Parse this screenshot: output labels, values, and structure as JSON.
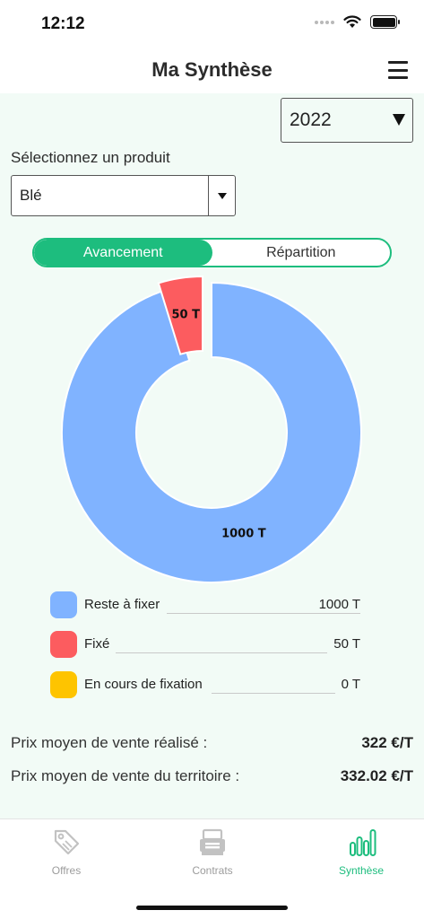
{
  "status_bar": {
    "time": "12:12"
  },
  "header": {
    "title": "Ma Synthèse"
  },
  "year_select": {
    "value": "2022"
  },
  "product": {
    "label": "Sélectionnez un produit",
    "value": "Blé"
  },
  "tabs": {
    "active": "Avancement",
    "inactive": "Répartition"
  },
  "chart_data": {
    "type": "pie",
    "categories": [
      "Reste à fixer",
      "Fixé",
      "En cours de fixation"
    ],
    "values": [
      1000,
      50,
      0
    ],
    "labels": [
      "1000 T",
      "50 T",
      "0 T"
    ],
    "colors": [
      "#80b3ff",
      "#fc5c5f",
      "#fec400"
    ]
  },
  "legend": [
    {
      "label": "Reste à fixer",
      "value": "1000 T",
      "color": "#80b3ff"
    },
    {
      "label": "Fixé",
      "value": "50 T",
      "color": "#fc5c5f"
    },
    {
      "label": "En cours de fixation",
      "value": "0 T",
      "color": "#fec400"
    }
  ],
  "prices": [
    {
      "label": "Prix moyen de vente réalisé :",
      "value": "322 €/T"
    },
    {
      "label": "Prix moyen de vente du territoire :",
      "value": "332.02 €/T"
    }
  ],
  "bottom_nav": [
    {
      "label": "Offres",
      "icon": "tag-icon"
    },
    {
      "label": "Contrats",
      "icon": "contracts-icon"
    },
    {
      "label": "Synthèse",
      "icon": "bar-chart-icon"
    }
  ],
  "accent_color": "#1dbd7e"
}
